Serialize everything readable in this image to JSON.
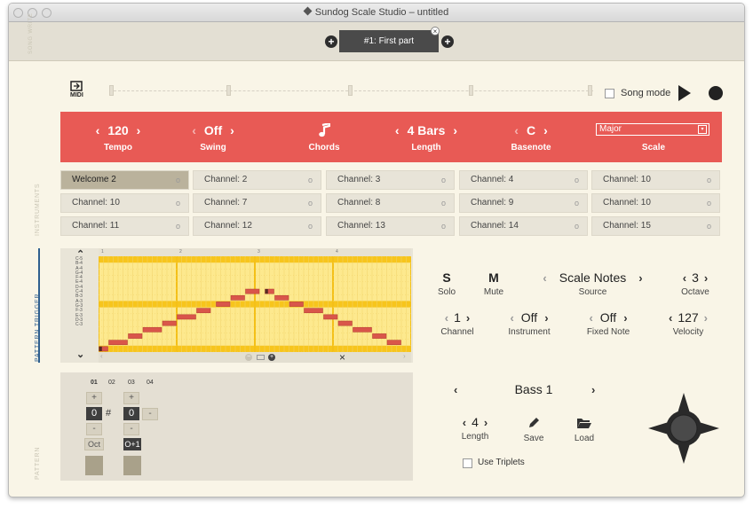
{
  "window": {
    "title": "Sundog Scale Studio – untitled"
  },
  "song": {
    "side_label": "SONG WRITE",
    "part_label": "#1: First part",
    "add_left": "+",
    "add_right": "+",
    "close": "×"
  },
  "transport": {
    "midi_label": "MIDI",
    "song_mode_label": "Song mode"
  },
  "redbar": {
    "tempo": {
      "value": "120",
      "label": "Tempo"
    },
    "swing": {
      "value": "Off",
      "label": "Swing"
    },
    "chords": {
      "label": "Chords"
    },
    "length": {
      "value": "4 Bars",
      "label": "Length"
    },
    "basenote": {
      "value": "C",
      "label": "Basenote"
    },
    "scale": {
      "value": "Major",
      "label": "Scale"
    },
    "left": "‹",
    "right": "›"
  },
  "instruments": {
    "side_label": "INSTRUMENTS",
    "channels": [
      "Welcome 2",
      "Channel: 2",
      "Channel: 3",
      "Channel: 4",
      "Channel: 10",
      "Channel: 10",
      "Channel: 7",
      "Channel: 8",
      "Channel: 9",
      "Channel: 10",
      "Channel: 11",
      "Channel: 12",
      "Channel: 13",
      "Channel: 14",
      "Channel: 15"
    ],
    "dot": "o"
  },
  "piano_roll": {
    "side_label": "PATTERN TRIGGER",
    "keys": [
      "C-5",
      "B-4",
      "A-4",
      "G-4",
      "F-4",
      "E-4",
      "D-4",
      "C-4",
      "B-3",
      "A-3",
      "G-3",
      "F-3",
      "E-3",
      "D-3",
      "C-3"
    ],
    "bars": [
      "1",
      "2",
      "3",
      "4"
    ],
    "up": "⌃",
    "down": "⌄",
    "close": "×"
  },
  "controls": {
    "solo": {
      "value": "S",
      "label": "Solo"
    },
    "mute": {
      "value": "M",
      "label": "Mute"
    },
    "source": {
      "value": "Scale Notes",
      "label": "Source"
    },
    "octave": {
      "value": "3",
      "label": "Octave"
    },
    "channel": {
      "value": "1",
      "label": "Channel"
    },
    "instrument": {
      "value": "Off",
      "label": "Instrument"
    },
    "fixed_note": {
      "value": "Off",
      "label": "Fixed Note"
    },
    "velocity": {
      "value": "127",
      "label": "Velocity"
    }
  },
  "pattern": {
    "side_label": "PATTERN",
    "columns": [
      "01",
      "02",
      "03",
      "04"
    ],
    "plus": "+",
    "minus": "-",
    "val1": "0",
    "sharp": "#",
    "val2": "0",
    "minus2": "-",
    "oct": "Oct",
    "oct2": "O+1"
  },
  "bass": {
    "name": "Bass 1",
    "length": {
      "value": "4",
      "label": "Length"
    },
    "save_label": "Save",
    "load_label": "Load",
    "triplets_label": "Use Triplets"
  },
  "colors": {
    "accent": "#e85a55",
    "grid_yellow": "#fde98e",
    "note_red": "#d9564a"
  }
}
